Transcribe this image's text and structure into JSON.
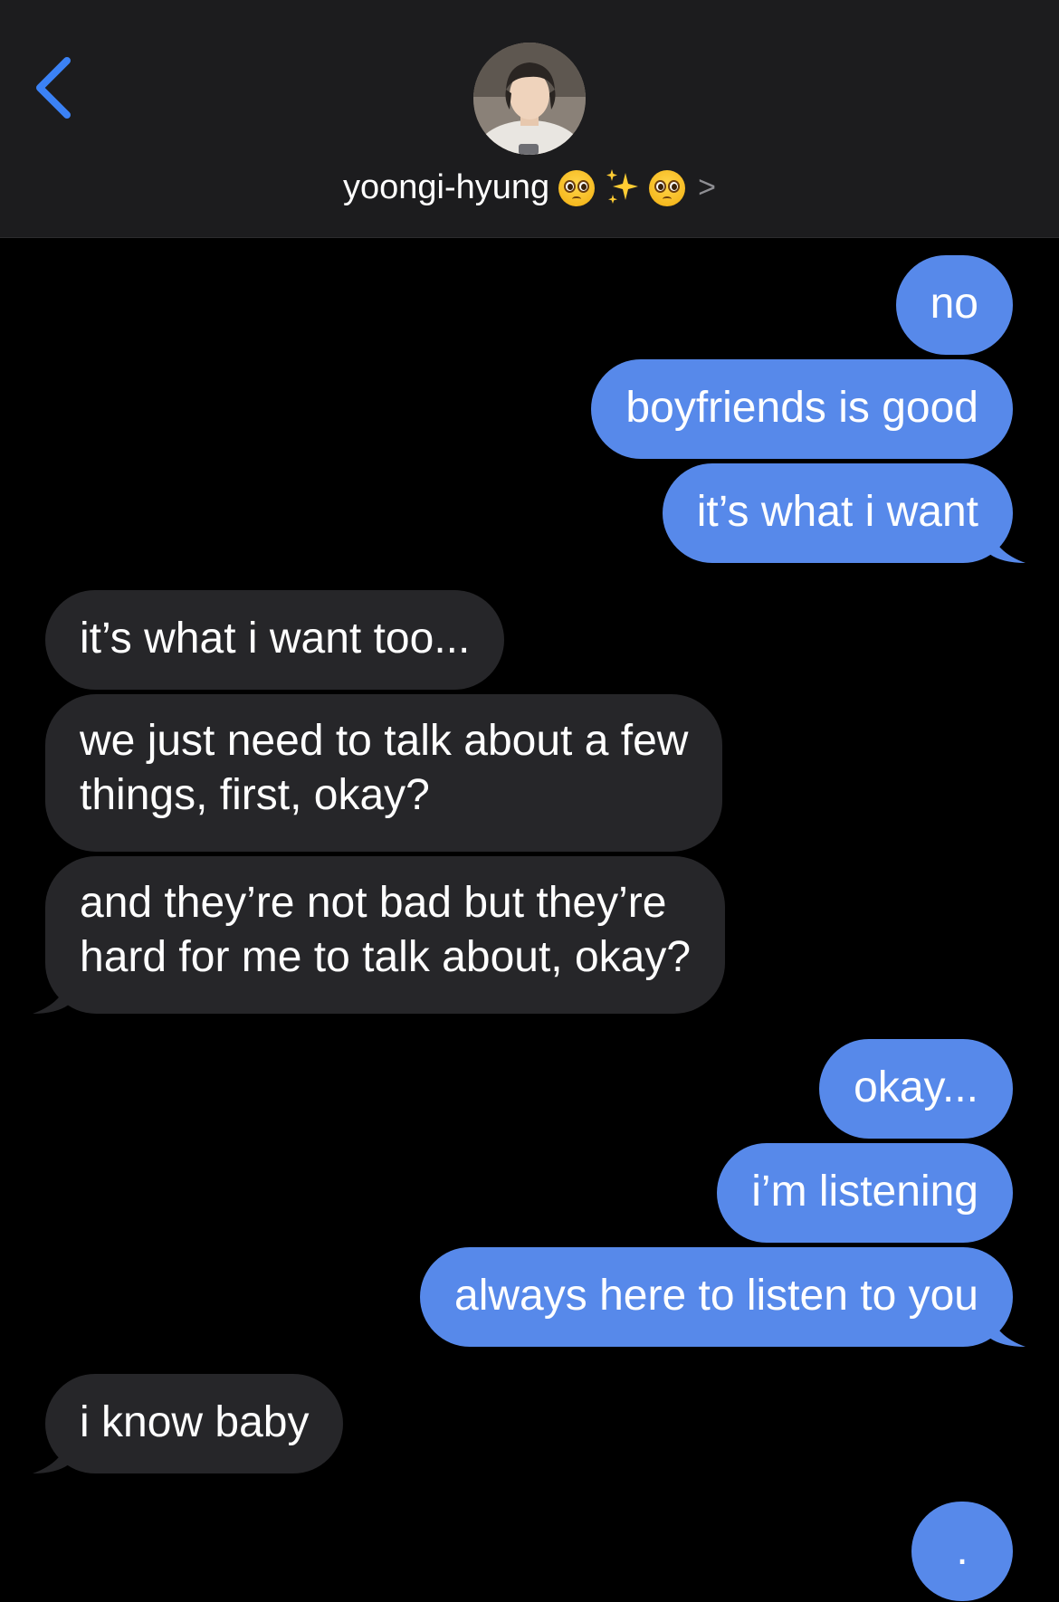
{
  "header": {
    "contact_name": "yoongi-hyung",
    "emoji_suffix": [
      "pleading-face",
      "sparkles",
      "pleading-face"
    ],
    "chevron": ">"
  },
  "messages": [
    {
      "side": "sent",
      "text": "no"
    },
    {
      "side": "sent",
      "text": "boyfriends is good"
    },
    {
      "side": "sent",
      "text": "it’s what i want"
    },
    {
      "side": "received",
      "text": "it’s what i want too..."
    },
    {
      "side": "received",
      "line1": "we just need to talk about a few",
      "line2": "things, first, okay?"
    },
    {
      "side": "received",
      "line1": "and they’re not bad but they’re",
      "line2": "hard for me to talk about, okay?"
    },
    {
      "side": "sent",
      "text": "okay..."
    },
    {
      "side": "sent",
      "text": "i’m listening"
    },
    {
      "side": "sent",
      "text": "always here to listen to you"
    },
    {
      "side": "received",
      "text": "i know baby"
    },
    {
      "side": "sent",
      "text": "."
    }
  ],
  "colors": {
    "sent_bubble": "#5789ea",
    "received_bubble": "#262629",
    "header_bg": "#1c1c1e",
    "back_arrow": "#3b82f6",
    "background": "#000000"
  },
  "icons": {
    "back": "chevron-left-icon",
    "avatar": "contact-avatar"
  }
}
